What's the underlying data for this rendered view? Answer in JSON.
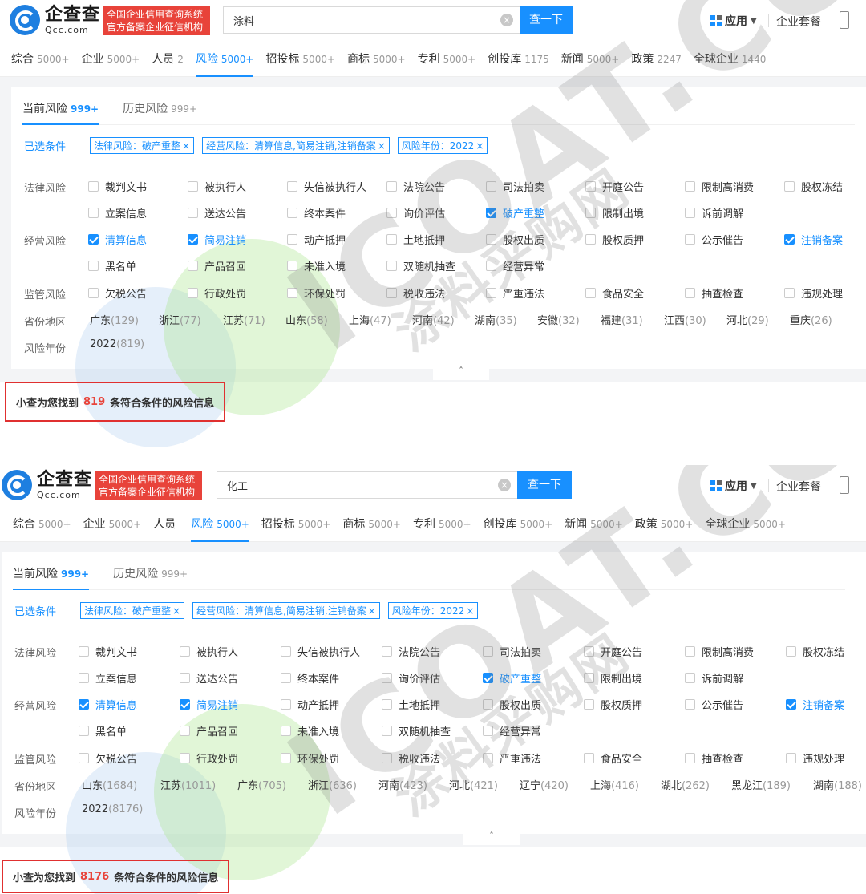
{
  "logo": {
    "cn": "企查查",
    "en": "Qcc.com",
    "slogan": "全国企业信用查询系统官方备案企业征信机构"
  },
  "header": {
    "search_btn": "查一下",
    "app_label": "应用",
    "pkg_label": "企业套餐",
    "clear_icon": "×"
  },
  "subtabs": [
    {
      "label": "当前风险",
      "count": "999+"
    },
    {
      "label": "历史风险",
      "count": "999+"
    }
  ],
  "selected_label": "已选条件",
  "chips": [
    "法律风险：破产重整",
    "经营风险：清算信息,简易注销,注销备案",
    "风险年份：2022"
  ],
  "chip_close": "×",
  "labels": {
    "legal": "法律风险",
    "business": "经营风险",
    "regulatory": "监管风险",
    "region": "省份地区",
    "year": "风险年份"
  },
  "legal_row1": [
    "裁判文书",
    "被执行人",
    "失信被执行人",
    "法院公告",
    "司法拍卖",
    "开庭公告",
    "限制高消费",
    "股权冻结"
  ],
  "legal_row2": [
    "立案信息",
    "送达公告",
    "终本案件",
    "询价评估",
    "破产重整",
    "限制出境",
    "诉前调解"
  ],
  "business_row1": [
    "清算信息",
    "简易注销",
    "动产抵押",
    "土地抵押",
    "股权出质",
    "股权质押",
    "公示催告",
    "注销备案"
  ],
  "business_row2": [
    "黑名单",
    "产品召回",
    "未准入境",
    "双随机抽查",
    "经营异常"
  ],
  "regulatory_row": [
    "欠税公告",
    "行政处罚",
    "环保处罚",
    "税收违法",
    "严重违法",
    "食品安全",
    "抽查检查",
    "违规处理"
  ],
  "collapse_icon": "ˆ",
  "result_prefix": "小查为您找到",
  "result_suffix": "条符合条件的风险信息",
  "watermark": {
    "big": "ICOAT.CC",
    "small": "涂料采购网"
  },
  "panels": [
    {
      "query": "涂料",
      "tabs": [
        {
          "label": "综合",
          "count": "5000+"
        },
        {
          "label": "企业",
          "count": "5000+"
        },
        {
          "label": "人员",
          "count": "2"
        },
        {
          "label": "风险",
          "count": "5000+"
        },
        {
          "label": "招投标",
          "count": "5000+"
        },
        {
          "label": "商标",
          "count": "5000+"
        },
        {
          "label": "专利",
          "count": "5000+"
        },
        {
          "label": "创投库",
          "count": "1175"
        },
        {
          "label": "新闻",
          "count": "5000+"
        },
        {
          "label": "政策",
          "count": "2247"
        },
        {
          "label": "全球企业",
          "count": "1440"
        }
      ],
      "regions": [
        {
          "name": "广东",
          "n": "(129)"
        },
        {
          "name": "浙江",
          "n": "(77)"
        },
        {
          "name": "江苏",
          "n": "(71)"
        },
        {
          "name": "山东",
          "n": "(58)"
        },
        {
          "name": "上海",
          "n": "(47)"
        },
        {
          "name": "河南",
          "n": "(42)"
        },
        {
          "name": "湖南",
          "n": "(35)"
        },
        {
          "name": "安徽",
          "n": "(32)"
        },
        {
          "name": "福建",
          "n": "(31)"
        },
        {
          "name": "江西",
          "n": "(30)"
        },
        {
          "name": "河北",
          "n": "(29)"
        },
        {
          "name": "重庆",
          "n": "(26)"
        }
      ],
      "year": {
        "name": "2022",
        "n": "(819)"
      },
      "result_count": "819"
    },
    {
      "query": "化工",
      "tabs": [
        {
          "label": "综合",
          "count": "5000+"
        },
        {
          "label": "企业",
          "count": "5000+"
        },
        {
          "label": "人员",
          "count": ""
        },
        {
          "label": "风险",
          "count": "5000+"
        },
        {
          "label": "招投标",
          "count": "5000+"
        },
        {
          "label": "商标",
          "count": "5000+"
        },
        {
          "label": "专利",
          "count": "5000+"
        },
        {
          "label": "创投库",
          "count": "5000+"
        },
        {
          "label": "新闻",
          "count": "5000+"
        },
        {
          "label": "政策",
          "count": "5000+"
        },
        {
          "label": "全球企业",
          "count": "5000+"
        }
      ],
      "regions": [
        {
          "name": "山东",
          "n": "(1684)"
        },
        {
          "name": "江苏",
          "n": "(1011)"
        },
        {
          "name": "广东",
          "n": "(705)"
        },
        {
          "name": "浙江",
          "n": "(636)"
        },
        {
          "name": "河南",
          "n": "(423)"
        },
        {
          "name": "河北",
          "n": "(421)"
        },
        {
          "name": "辽宁",
          "n": "(420)"
        },
        {
          "name": "上海",
          "n": "(416)"
        },
        {
          "name": "湖北",
          "n": "(262)"
        },
        {
          "name": "黑龙江",
          "n": "(189)"
        },
        {
          "name": "湖南",
          "n": "(188)"
        }
      ],
      "year": {
        "name": "2022",
        "n": "(8176)"
      },
      "result_count": "8176"
    }
  ]
}
